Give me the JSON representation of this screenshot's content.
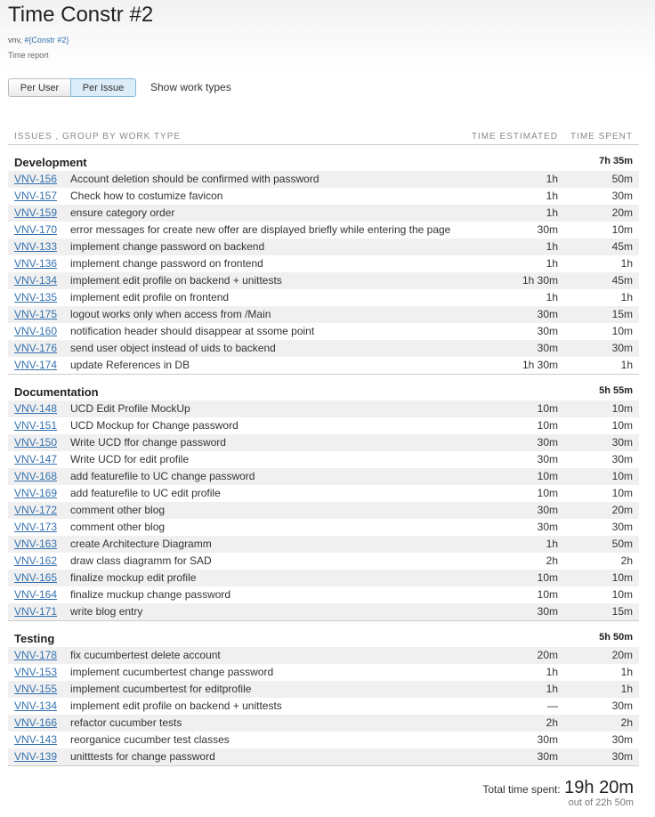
{
  "header": {
    "title": "Time Constr #2",
    "crumb_prefix": "vnv, ",
    "crumb_link": "#{Constr #2}",
    "subtitle": "Time report"
  },
  "toolbar": {
    "per_user_label": "Per User",
    "per_issue_label": "Per Issue",
    "show_work_types_label": "Show work types"
  },
  "table": {
    "col_issues": "ISSUES , GROUP BY WORK TYPE",
    "col_estimated": "TIME ESTIMATED",
    "col_spent": "TIME SPENT",
    "groups": [
      {
        "name": "Development",
        "total": "7h 35m",
        "rows": [
          {
            "key": "VNV-156",
            "summary": "Account deletion should be confirmed with password",
            "est": "1h",
            "spent": "50m"
          },
          {
            "key": "VNV-157",
            "summary": "Check how to costumize favicon",
            "est": "1h",
            "spent": "30m"
          },
          {
            "key": "VNV-159",
            "summary": "ensure category order",
            "est": "1h",
            "spent": "20m"
          },
          {
            "key": "VNV-170",
            "summary": "error messages for create new offer are displayed briefly while entering the page",
            "est": "30m",
            "spent": "10m"
          },
          {
            "key": "VNV-133",
            "summary": "implement change password on backend",
            "est": "1h",
            "spent": "45m"
          },
          {
            "key": "VNV-136",
            "summary": "implement change password on frontend",
            "est": "1h",
            "spent": "1h"
          },
          {
            "key": "VNV-134",
            "summary": "implement edit profile on backend + unittests",
            "est": "1h 30m",
            "spent": "45m"
          },
          {
            "key": "VNV-135",
            "summary": "implement edit profile on frontend",
            "est": "1h",
            "spent": "1h"
          },
          {
            "key": "VNV-175",
            "summary": "logout works only when access from /Main",
            "est": "30m",
            "spent": "15m"
          },
          {
            "key": "VNV-160",
            "summary": "notification header should disappear at ssome point",
            "est": "30m",
            "spent": "10m"
          },
          {
            "key": "VNV-176",
            "summary": "send user object instead of uids to backend",
            "est": "30m",
            "spent": "30m"
          },
          {
            "key": "VNV-174",
            "summary": "update References in DB",
            "est": "1h 30m",
            "spent": "1h"
          }
        ]
      },
      {
        "name": "Documentation",
        "total": "5h 55m",
        "rows": [
          {
            "key": "VNV-148",
            "summary": "UCD Edit Profile MockUp",
            "est": "10m",
            "spent": "10m"
          },
          {
            "key": "VNV-151",
            "summary": "UCD Mockup for Change password",
            "est": "10m",
            "spent": "10m"
          },
          {
            "key": "VNV-150",
            "summary": "Write UCD ffor change password",
            "est": "30m",
            "spent": "30m"
          },
          {
            "key": "VNV-147",
            "summary": "Write UCD for edit profile",
            "est": "30m",
            "spent": "30m"
          },
          {
            "key": "VNV-168",
            "summary": "add featurefile to UC change password",
            "est": "10m",
            "spent": "10m"
          },
          {
            "key": "VNV-169",
            "summary": "add featurefile to UC edit profile",
            "est": "10m",
            "spent": "10m"
          },
          {
            "key": "VNV-172",
            "summary": "comment other blog",
            "est": "30m",
            "spent": "20m"
          },
          {
            "key": "VNV-173",
            "summary": "comment other blog",
            "est": "30m",
            "spent": "30m"
          },
          {
            "key": "VNV-163",
            "summary": "create Architecture Diagramm",
            "est": "1h",
            "spent": "50m"
          },
          {
            "key": "VNV-162",
            "summary": "draw class diagramm for SAD",
            "est": "2h",
            "spent": "2h"
          },
          {
            "key": "VNV-165",
            "summary": "finalize mockup edit profile",
            "est": "10m",
            "spent": "10m"
          },
          {
            "key": "VNV-164",
            "summary": "finalize muckup change password",
            "est": "10m",
            "spent": "10m"
          },
          {
            "key": "VNV-171",
            "summary": "write blog entry",
            "est": "30m",
            "spent": "15m"
          }
        ]
      },
      {
        "name": "Testing",
        "total": "5h 50m",
        "rows": [
          {
            "key": "VNV-178",
            "summary": "fix cucumbertest delete account",
            "est": "20m",
            "spent": "20m"
          },
          {
            "key": "VNV-153",
            "summary": "implement cucumbertest change password",
            "est": "1h",
            "spent": "1h"
          },
          {
            "key": "VNV-155",
            "summary": "implement cucumbertest for editprofile",
            "est": "1h",
            "spent": "1h"
          },
          {
            "key": "VNV-134",
            "summary": "implement edit profile on backend + unittests",
            "est": "—",
            "spent": "30m"
          },
          {
            "key": "VNV-166",
            "summary": "refactor cucumber tests",
            "est": "2h",
            "spent": "2h"
          },
          {
            "key": "VNV-143",
            "summary": "reorganice cucumber test classes",
            "est": "30m",
            "spent": "30m"
          },
          {
            "key": "VNV-139",
            "summary": "unitttests for change password",
            "est": "30m",
            "spent": "30m"
          }
        ]
      }
    ]
  },
  "footer": {
    "total_label": "Total time spent:",
    "total_value": "19h 20m",
    "out_of": "out of 22h 50m"
  }
}
